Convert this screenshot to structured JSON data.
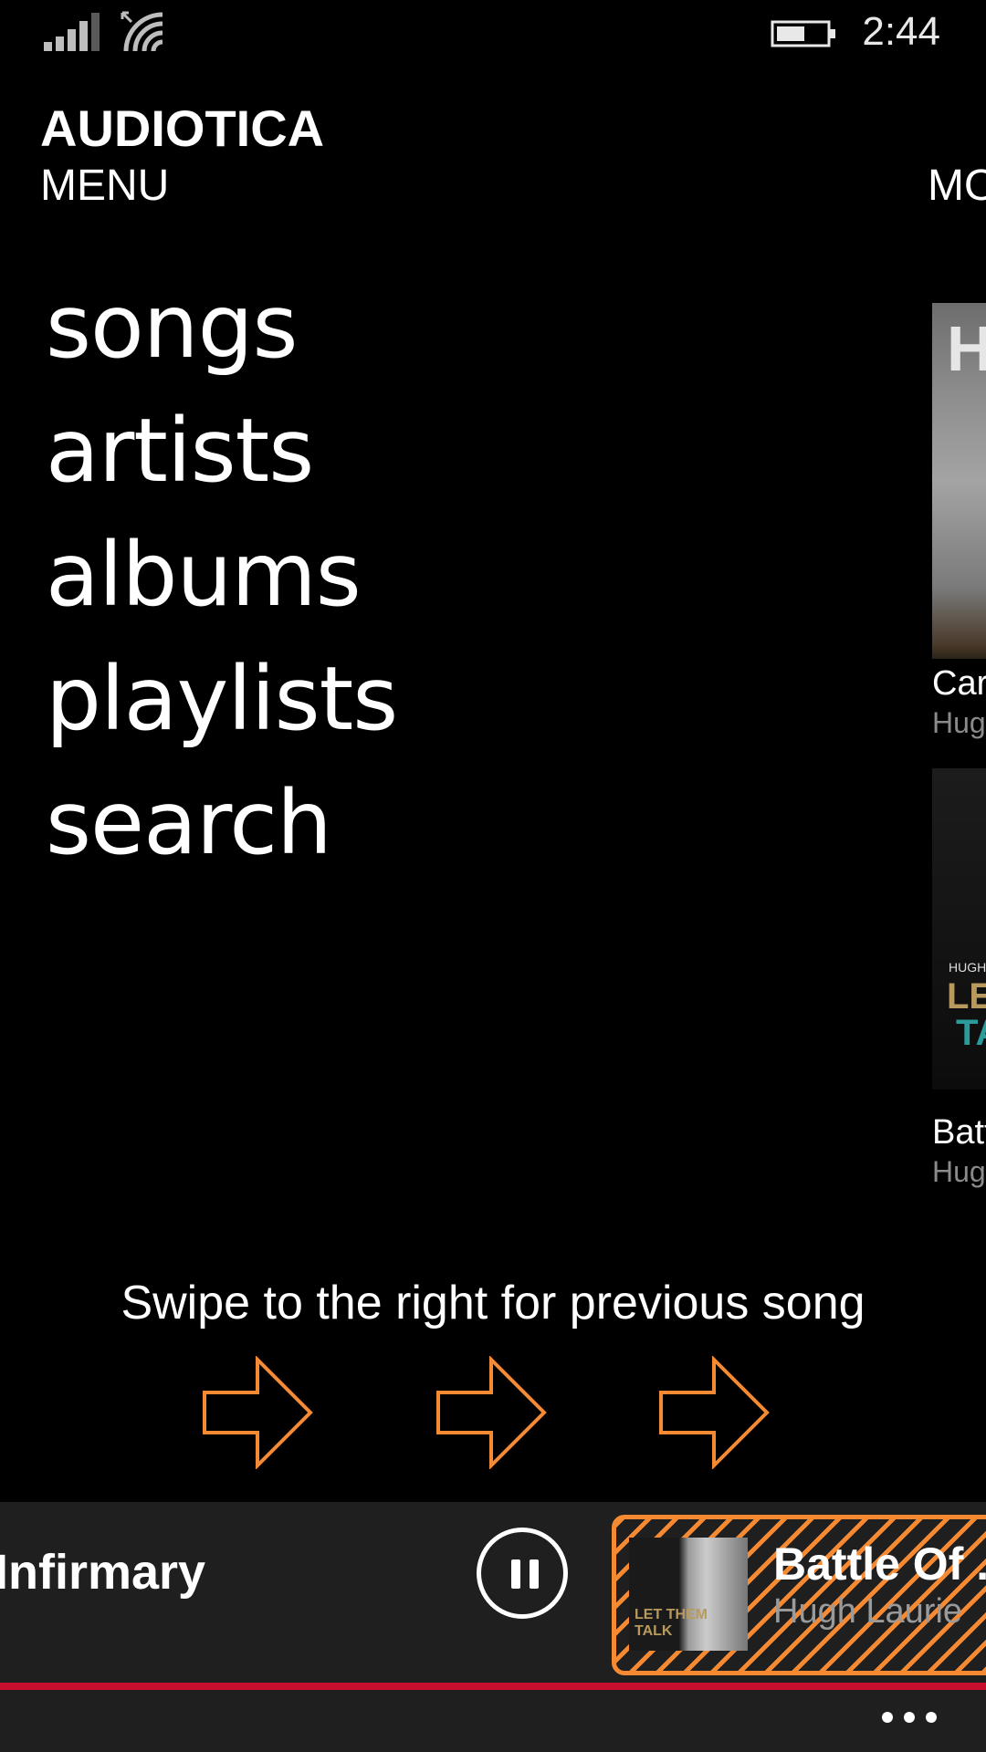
{
  "status_bar": {
    "time": "2:44",
    "icons": [
      "signal-strength-icon",
      "wifi-icon",
      "battery-icon"
    ]
  },
  "header": {
    "app_name": "AUDIOTICA",
    "pivot_current": "MENU",
    "pivot_next_peek": "MO"
  },
  "menu": {
    "items": [
      {
        "label": "songs"
      },
      {
        "label": "artists"
      },
      {
        "label": "albums"
      },
      {
        "label": "playlists"
      },
      {
        "label": "search"
      }
    ]
  },
  "peek_panel": {
    "items": [
      {
        "art_text": "HU",
        "title": "Car",
        "subtitle": "Hug"
      },
      {
        "art_small": "HUGH",
        "art_line1": "LET",
        "art_line2": "TA",
        "title": "Batt",
        "subtitle": "Hug"
      }
    ]
  },
  "swipe_hint": {
    "text": "Swipe to the right for previous song",
    "arrow_icon": "arrow-right-icon",
    "arrow_color": "#f58a33"
  },
  "now_playing": {
    "previous_track_title": "Infirmary",
    "pause_icon": "pause-icon",
    "next_track_title": "Battle Of .",
    "next_track_artist": "Hugh Laurie",
    "next_art_text": "LET THEM TALK",
    "highlight_color": "#f58a33",
    "progress_color": "#c8102e"
  },
  "app_bar": {
    "more_icon": "more-ellipsis-icon"
  }
}
